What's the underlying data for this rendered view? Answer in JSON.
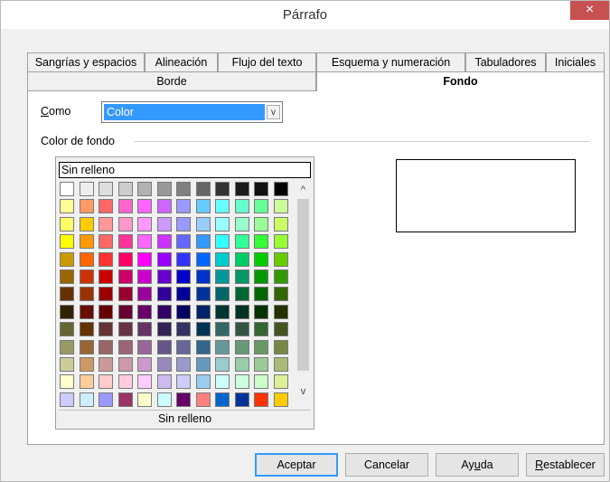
{
  "window": {
    "title": "Párrafo",
    "close_glyph": "×"
  },
  "tabs_row1": [
    {
      "label": "Sangrías y espacios"
    },
    {
      "label": "Alineación"
    },
    {
      "label": "Flujo del texto"
    },
    {
      "label": "Esquema y numeración"
    },
    {
      "label": "Tabuladores"
    },
    {
      "label": "Iniciales"
    }
  ],
  "tabs_row2": [
    {
      "label": "Borde",
      "active": false
    },
    {
      "label": "Fondo",
      "active": true
    }
  ],
  "como": {
    "label_first": "C",
    "label_rest": "omo",
    "selected": "Color",
    "arrow": "v"
  },
  "color_section": {
    "label": "Color de fondo",
    "no_fill_top": "Sin relleno",
    "no_fill_bottom": "Sin relleno"
  },
  "scroll": {
    "up": "^",
    "down": "v"
  },
  "palette_colors": [
    [
      "#ffffff",
      "#eeeeee",
      "#dddddd",
      "#cccccc",
      "#b2b2b2",
      "#999999",
      "#808080",
      "#666666",
      "#333333",
      "#1c1c1c",
      "#111111",
      "#000000"
    ],
    [
      "#ffff99",
      "#ff9966",
      "#ff6666",
      "#ff66cc",
      "#ff66ff",
      "#cc66ff",
      "#9999ff",
      "#66ccff",
      "#66ffff",
      "#66ffcc",
      "#66ff99",
      "#ccff99"
    ],
    [
      "#ffff66",
      "#ffcc00",
      "#ff9999",
      "#ff99cc",
      "#ff99ff",
      "#cc99ff",
      "#9999ff",
      "#99ccff",
      "#99ffff",
      "#99ffcc",
      "#99ff99",
      "#ccff66"
    ],
    [
      "#ffff00",
      "#ff9900",
      "#ff6666",
      "#ff3399",
      "#ff66ff",
      "#cc33ff",
      "#6666ff",
      "#3399ff",
      "#33ffff",
      "#33ff99",
      "#33ff33",
      "#99ff33"
    ],
    [
      "#cc9900",
      "#ff6600",
      "#ff3333",
      "#ff0066",
      "#ff00ff",
      "#9900ff",
      "#3333ff",
      "#0066ff",
      "#00cccc",
      "#00cc66",
      "#00cc00",
      "#66cc00"
    ],
    [
      "#996600",
      "#cc3300",
      "#cc0000",
      "#cc0066",
      "#cc00cc",
      "#6600cc",
      "#0000cc",
      "#0033cc",
      "#009999",
      "#009966",
      "#009900",
      "#339900"
    ],
    [
      "#663300",
      "#993300",
      "#990000",
      "#990033",
      "#990099",
      "#330099",
      "#000099",
      "#003399",
      "#006666",
      "#006633",
      "#006600",
      "#336600"
    ],
    [
      "#332200",
      "#661100",
      "#660000",
      "#660033",
      "#660066",
      "#330066",
      "#000066",
      "#002266",
      "#003333",
      "#003322",
      "#003300",
      "#223300"
    ],
    [
      "#666633",
      "#663300",
      "#663333",
      "#663344",
      "#663366",
      "#332255",
      "#333366",
      "#003355",
      "#336666",
      "#335544",
      "#336633",
      "#445522"
    ],
    [
      "#999966",
      "#996633",
      "#996666",
      "#996677",
      "#996699",
      "#665588",
      "#666699",
      "#336688",
      "#669999",
      "#669977",
      "#669966",
      "#778844"
    ],
    [
      "#cccc99",
      "#cc9966",
      "#cc9999",
      "#cc99aa",
      "#cc99cc",
      "#9988bb",
      "#9999cc",
      "#6699bb",
      "#99cccc",
      "#99ccaa",
      "#99cc99",
      "#aabb77"
    ],
    [
      "#ffffcc",
      "#ffcc99",
      "#ffcccc",
      "#ffccdd",
      "#ffccff",
      "#ccbbee",
      "#ccccff",
      "#99ccee",
      "#ccffff",
      "#ccffdd",
      "#ccffcc",
      "#ddee99"
    ],
    [
      "#ccccff",
      "#cceeff",
      "#9999ff",
      "#993366",
      "#ffffcc",
      "#ccffff",
      "#660066",
      "#ff8080",
      "#0066cc",
      "#003399",
      "#ff3300",
      "#ffcc00"
    ]
  ],
  "buttons": {
    "ok": "Aceptar",
    "cancel": "Cancelar",
    "help_pre": "Ay",
    "help_u": "u",
    "help_post": "da",
    "reset_u": "R",
    "reset_rest": "establecer"
  }
}
